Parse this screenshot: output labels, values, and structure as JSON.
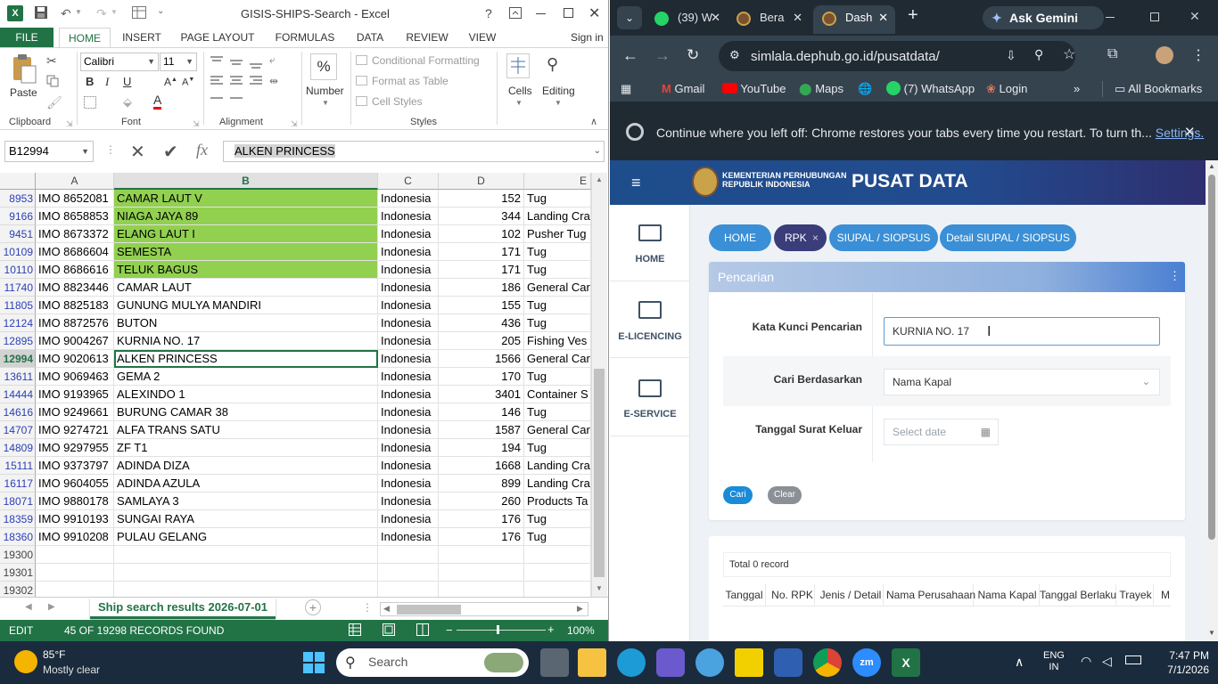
{
  "excel": {
    "title": "GISIS-SHIPS-Search - Excel",
    "title_help": "?",
    "file_tab": "FILE",
    "tabs": [
      "HOME",
      "INSERT",
      "PAGE LAYOUT",
      "FORMULAS",
      "DATA",
      "REVIEW",
      "VIEW"
    ],
    "sign_in": "Sign in",
    "ribbon": {
      "paste": "Paste",
      "font_name": "Calibri",
      "font_size": "11",
      "number": "Number",
      "conditional_formatting": "Conditional Formatting",
      "format_as_table": "Format as Table",
      "cell_styles": "Cell Styles",
      "cells": "Cells",
      "editing": "Editing",
      "groups": {
        "clipboard": "Clipboard",
        "font": "Font",
        "alignment": "Alignment",
        "styles": "Styles"
      }
    },
    "name_box": "B12994",
    "fx": "fx",
    "formula_value": "ALKEN PRINCESS",
    "columns": [
      "A",
      "B",
      "C",
      "D",
      "E"
    ],
    "rows": [
      {
        "n": "8953",
        "a": "IMO 8652081",
        "b": "CAMAR LAUT V",
        "c": "Indonesia",
        "d": "152",
        "e": "Tug",
        "green": true
      },
      {
        "n": "9166",
        "a": "IMO 8658853",
        "b": "NIAGA JAYA 89",
        "c": "Indonesia",
        "d": "344",
        "e": "Landing Cra",
        "green": true
      },
      {
        "n": "9451",
        "a": "IMO 8673372",
        "b": "ELANG LAUT I",
        "c": "Indonesia",
        "d": "102",
        "e": "Pusher Tug",
        "green": true
      },
      {
        "n": "10109",
        "a": "IMO 8686604",
        "b": "SEMESTA",
        "c": "Indonesia",
        "d": "171",
        "e": "Tug",
        "green": true
      },
      {
        "n": "10110",
        "a": "IMO 8686616",
        "b": "TELUK BAGUS",
        "c": "Indonesia",
        "d": "171",
        "e": "Tug",
        "green": true
      },
      {
        "n": "11740",
        "a": "IMO 8823446",
        "b": "CAMAR LAUT",
        "c": "Indonesia",
        "d": "186",
        "e": "General Car",
        "green": false
      },
      {
        "n": "11805",
        "a": "IMO 8825183",
        "b": "GUNUNG MULYA MANDIRI",
        "c": "Indonesia",
        "d": "155",
        "e": "Tug",
        "green": false
      },
      {
        "n": "12124",
        "a": "IMO 8872576",
        "b": "BUTON",
        "c": "Indonesia",
        "d": "436",
        "e": "Tug",
        "green": false
      },
      {
        "n": "12895",
        "a": "IMO 9004267",
        "b": "KURNIA NO. 17",
        "c": "Indonesia",
        "d": "205",
        "e": "Fishing Ves",
        "green": false
      },
      {
        "n": "12994",
        "a": "IMO 9020613",
        "b": "ALKEN PRINCESS",
        "c": "Indonesia",
        "d": "1566",
        "e": "General Car",
        "green": false
      },
      {
        "n": "13611",
        "a": "IMO 9069463",
        "b": "GEMA 2",
        "c": "Indonesia",
        "d": "170",
        "e": "Tug",
        "green": false
      },
      {
        "n": "14444",
        "a": "IMO 9193965",
        "b": "ALEXINDO 1",
        "c": "Indonesia",
        "d": "3401",
        "e": "Container S",
        "green": false
      },
      {
        "n": "14616",
        "a": "IMO 9249661",
        "b": "BURUNG CAMAR 38",
        "c": "Indonesia",
        "d": "146",
        "e": "Tug",
        "green": false
      },
      {
        "n": "14707",
        "a": "IMO 9274721",
        "b": "ALFA TRANS SATU",
        "c": "Indonesia",
        "d": "1587",
        "e": "General Car",
        "green": false
      },
      {
        "n": "14809",
        "a": "IMO 9297955",
        "b": "ZF T1",
        "c": "Indonesia",
        "d": "194",
        "e": "Tug",
        "green": false
      },
      {
        "n": "15111",
        "a": "IMO 9373797",
        "b": "ADINDA DIZA",
        "c": "Indonesia",
        "d": "1668",
        "e": "Landing Cra",
        "green": false
      },
      {
        "n": "16117",
        "a": "IMO 9604055",
        "b": "ADINDA AZULA",
        "c": "Indonesia",
        "d": "899",
        "e": "Landing Cra",
        "green": false
      },
      {
        "n": "18071",
        "a": "IMO 9880178",
        "b": "SAMLAYA 3",
        "c": "Indonesia",
        "d": "260",
        "e": "Products Ta",
        "green": false
      },
      {
        "n": "18359",
        "a": "IMO 9910193",
        "b": "SUNGAI RAYA",
        "c": "Indonesia",
        "d": "176",
        "e": "Tug",
        "green": false
      },
      {
        "n": "18360",
        "a": "IMO 9910208",
        "b": "PULAU GELANG",
        "c": "Indonesia",
        "d": "176",
        "e": "Tug",
        "green": false
      },
      {
        "n": "19300",
        "a": "",
        "b": "",
        "c": "",
        "d": "",
        "e": "",
        "green": false
      },
      {
        "n": "19301",
        "a": "",
        "b": "",
        "c": "",
        "d": "",
        "e": "",
        "green": false
      },
      {
        "n": "19302",
        "a": "",
        "b": "",
        "c": "",
        "d": "",
        "e": "",
        "green": false
      }
    ],
    "selected_row": "12994",
    "sheet_tab": "Ship search results 2026-07-01",
    "status_mode": "EDIT",
    "status_text": "45 OF 19298 RECORDS FOUND",
    "zoom": "100%",
    "colors": {
      "green": "#217346",
      "highlight": "#92d050"
    }
  },
  "chrome": {
    "tabs": [
      {
        "label": "(39) W",
        "badge": "39"
      },
      {
        "label": "Bera",
        "badge": ""
      },
      {
        "label": "Dash",
        "badge": ""
      }
    ],
    "ask_gemini": "Ask Gemini",
    "url": "simlala.dephub.go.id/pusatdata/",
    "bookmarks": [
      {
        "label": "Gmail",
        "icon": "gmail-icon"
      },
      {
        "label": "YouTube",
        "icon": "youtube-icon"
      },
      {
        "label": "Maps",
        "icon": "maps-icon"
      },
      {
        "label": "",
        "icon": "globe-icon"
      },
      {
        "label": "(7) WhatsApp",
        "icon": "whatsapp-icon"
      },
      {
        "label": "Login",
        "icon": "login-icon"
      }
    ],
    "all_bookmarks": "All Bookmarks",
    "info_bar": {
      "text": "Continue where you left off: Chrome restores your tabs every time you restart. To turn th...",
      "link": "Settings."
    }
  },
  "site": {
    "logo_line1": "KEMENTERIAN PERHUBUNGAN",
    "logo_line2": "REPUBLIK INDONESIA",
    "title": "PUSAT DATA",
    "nav": [
      {
        "label": "HOME",
        "icon": "monitor-icon"
      },
      {
        "label": "E-LICENCING",
        "icon": "id-card-icon"
      },
      {
        "label": "E-SERVICE",
        "icon": "id-card-icon"
      }
    ],
    "crumbs": [
      "HOME",
      "RPK",
      "SIUPAL / SIOPSUS",
      "Detail SIUPAL / SIOPSUS"
    ],
    "crumb_close": "×",
    "panel_title": "Pencarian",
    "fields": {
      "keyword_label": "Kata Kunci Pencarian",
      "keyword_value": "KURNIA NO. 17",
      "search_by_label": "Cari Berdasarkan",
      "search_by_value": "Nama Kapal",
      "date_label": "Tanggal Surat Keluar",
      "date_placeholder": "Select date"
    },
    "buttons": {
      "search": "Cari",
      "clear": "Clear"
    },
    "total": "Total 0 record",
    "table_headers": [
      "Tanggal",
      "No. RPK",
      "Jenis / Detail",
      "Nama Perusahaan",
      "Nama Kapal",
      "Tanggal Berlaku",
      "Trayek",
      "M"
    ]
  },
  "taskbar": {
    "weather_temp": "85°F",
    "weather_text": "Mostly clear",
    "search_placeholder": "Search",
    "lang_top": "ENG",
    "lang_bottom": "IN",
    "time": "7:47 PM",
    "date": "7/1/2026"
  }
}
